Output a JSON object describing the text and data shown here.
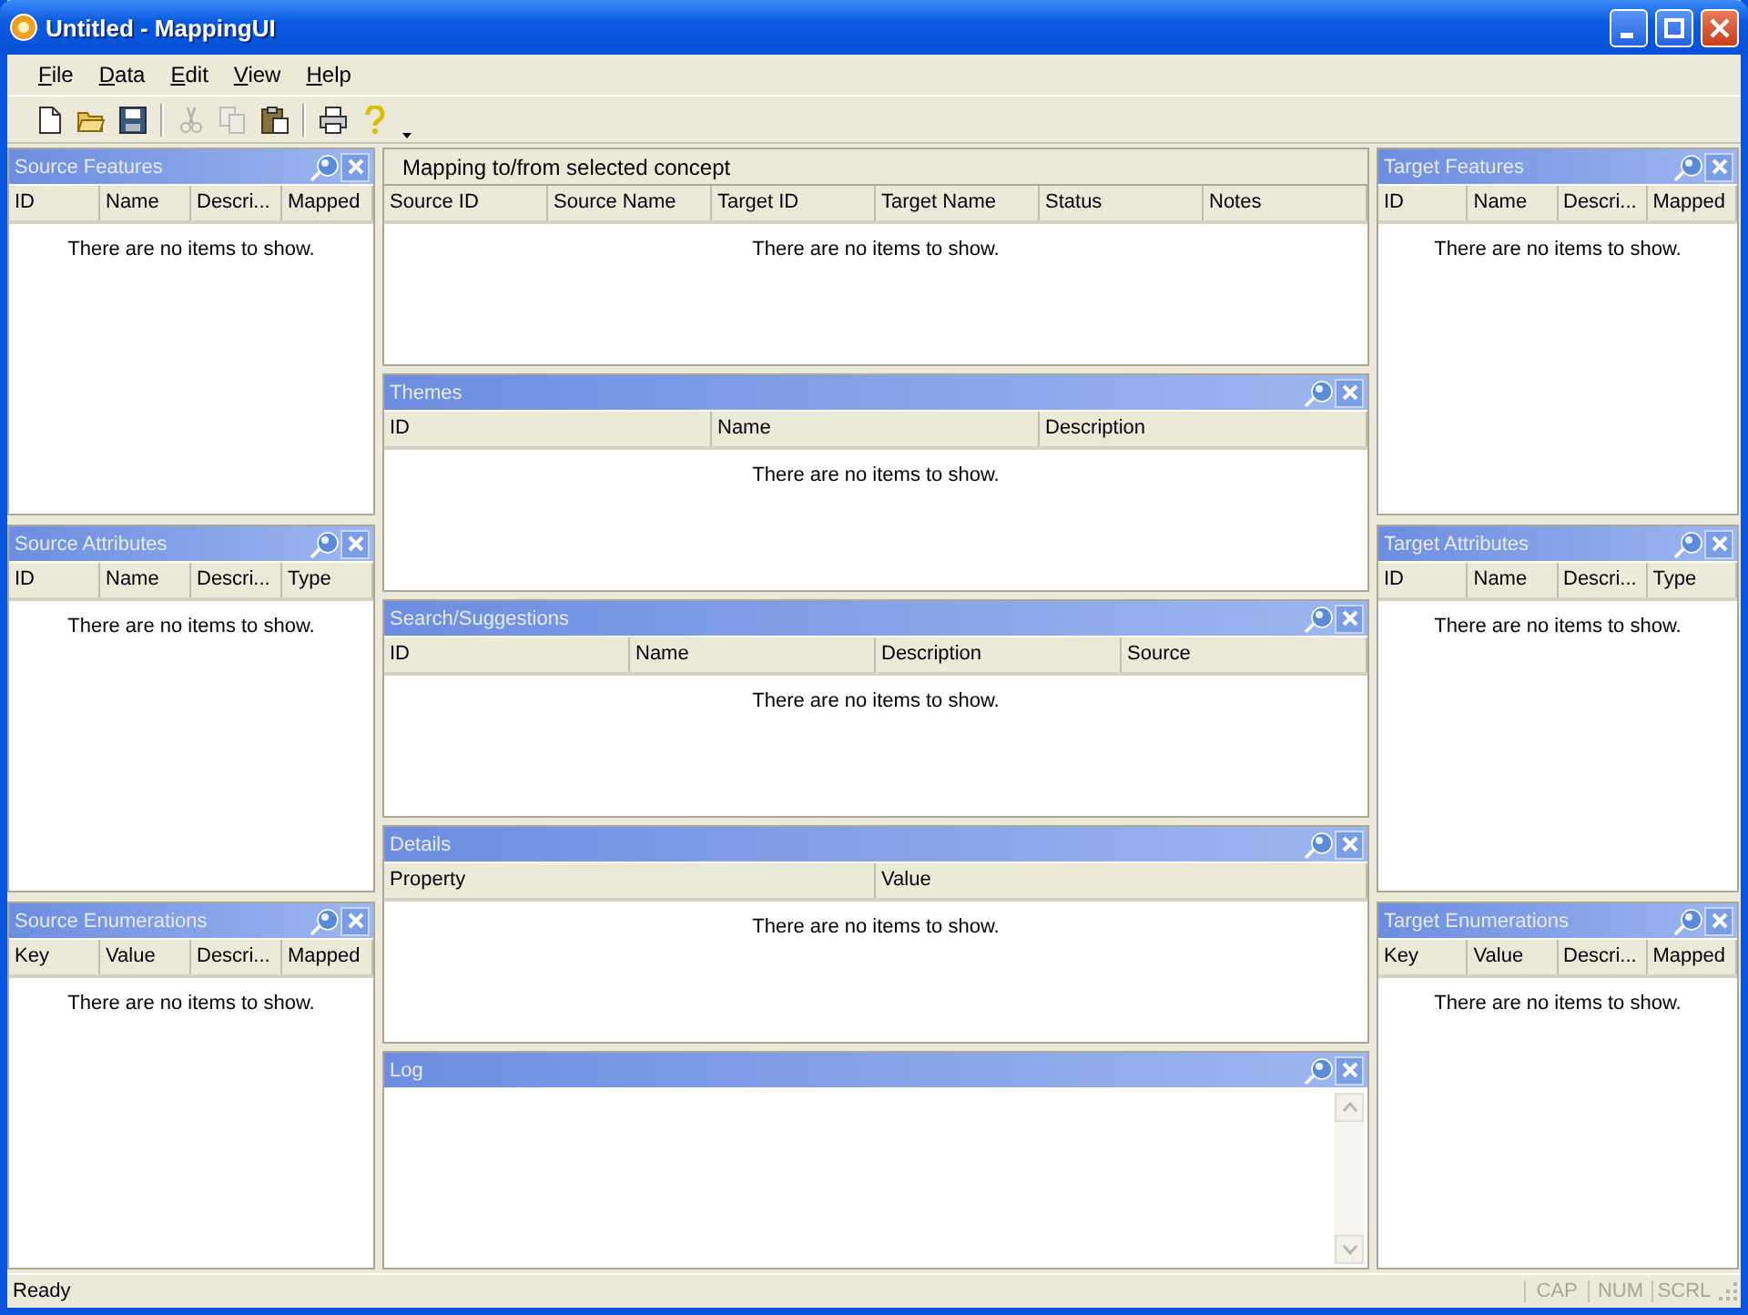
{
  "window": {
    "title": "Untitled - MappingUI"
  },
  "menu": [
    {
      "label": "File"
    },
    {
      "label": "Data"
    },
    {
      "label": "Edit"
    },
    {
      "label": "View"
    },
    {
      "label": "Help"
    }
  ],
  "toolbar": [
    {
      "kind": "new",
      "disabled": false
    },
    {
      "kind": "open",
      "disabled": false
    },
    {
      "kind": "save",
      "disabled": false
    },
    {
      "kind": "separator"
    },
    {
      "kind": "cut",
      "disabled": true
    },
    {
      "kind": "copy",
      "disabled": true
    },
    {
      "kind": "paste",
      "disabled": false
    },
    {
      "kind": "separator"
    },
    {
      "kind": "print",
      "disabled": false
    },
    {
      "kind": "help",
      "disabled": false
    },
    {
      "kind": "overflow"
    }
  ],
  "left_panels": [
    {
      "title": "Source Features",
      "columns": [
        "ID",
        "Name",
        "Descri...",
        "Mapped"
      ],
      "empty_text": "There are no items to show."
    },
    {
      "title": "Source Attributes",
      "columns": [
        "ID",
        "Name",
        "Descri...",
        "Type"
      ],
      "empty_text": "There are no items to show."
    },
    {
      "title": "Source Enumerations",
      "columns": [
        "Key",
        "Value",
        "Descri...",
        "Mapped"
      ],
      "empty_text": "There are no items to show."
    }
  ],
  "center_panels": [
    {
      "kind": "caption",
      "title": "Mapping to/from selected concept",
      "columns": [
        "Source ID",
        "Source Name",
        "Target ID",
        "Target Name",
        "Status",
        "Notes"
      ],
      "empty_text": "There are no items to show."
    },
    {
      "kind": "list",
      "title": "Themes",
      "columns": [
        "ID",
        "Name",
        "Description"
      ],
      "empty_text": "There are no items to show."
    },
    {
      "kind": "list",
      "title": "Search/Suggestions",
      "columns": [
        "ID",
        "Name",
        "Description",
        "Source"
      ],
      "empty_text": "There are no items to show."
    },
    {
      "kind": "list",
      "title": "Details",
      "columns": [
        "Property",
        "Value"
      ],
      "empty_text": "There are no items to show."
    },
    {
      "kind": "log",
      "title": "Log"
    }
  ],
  "right_panels": [
    {
      "title": "Target Features",
      "columns": [
        "ID",
        "Name",
        "Descri...",
        "Mapped"
      ],
      "empty_text": "There are no items to show."
    },
    {
      "title": "Target Attributes",
      "columns": [
        "ID",
        "Name",
        "Descri...",
        "Type"
      ],
      "empty_text": "There are no items to show."
    },
    {
      "title": "Target Enumerations",
      "columns": [
        "Key",
        "Value",
        "Descri...",
        "Mapped"
      ],
      "empty_text": "There are no items to show."
    }
  ],
  "status_bar": {
    "text": "Ready",
    "indicators": [
      "CAP",
      "NUM",
      "SCRL"
    ]
  }
}
